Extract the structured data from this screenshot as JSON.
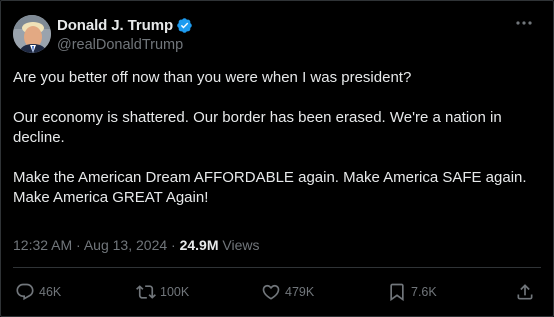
{
  "author": {
    "display_name": "Donald J. Trump",
    "handle": "@realDonaldTrump",
    "verified": true,
    "verified_color": "#1d9bf0"
  },
  "post": {
    "paragraphs": [
      "Are you better off now than you were when I was president?",
      "Our economy is shattered. Our border has been erased. We're a nation in decline.",
      "Make the American Dream AFFORDABLE again. Make America SAFE again. Make America GREAT Again!"
    ]
  },
  "meta": {
    "time": "12:32 AM",
    "separator": "·",
    "date": "Aug 13, 2024",
    "views_count": "24.9M",
    "views_label": "Views"
  },
  "actions": {
    "replies": "46K",
    "reposts": "100K",
    "likes": "479K",
    "bookmarks": "7.6K"
  },
  "icons": {
    "more": "more-horizontal-icon",
    "reply": "reply-icon",
    "repost": "repost-icon",
    "like": "heart-icon",
    "bookmark": "bookmark-icon",
    "share": "share-icon"
  },
  "colors": {
    "background": "#000000",
    "text": "#e7e9ea",
    "muted": "#71767b",
    "border": "#2f3336"
  }
}
